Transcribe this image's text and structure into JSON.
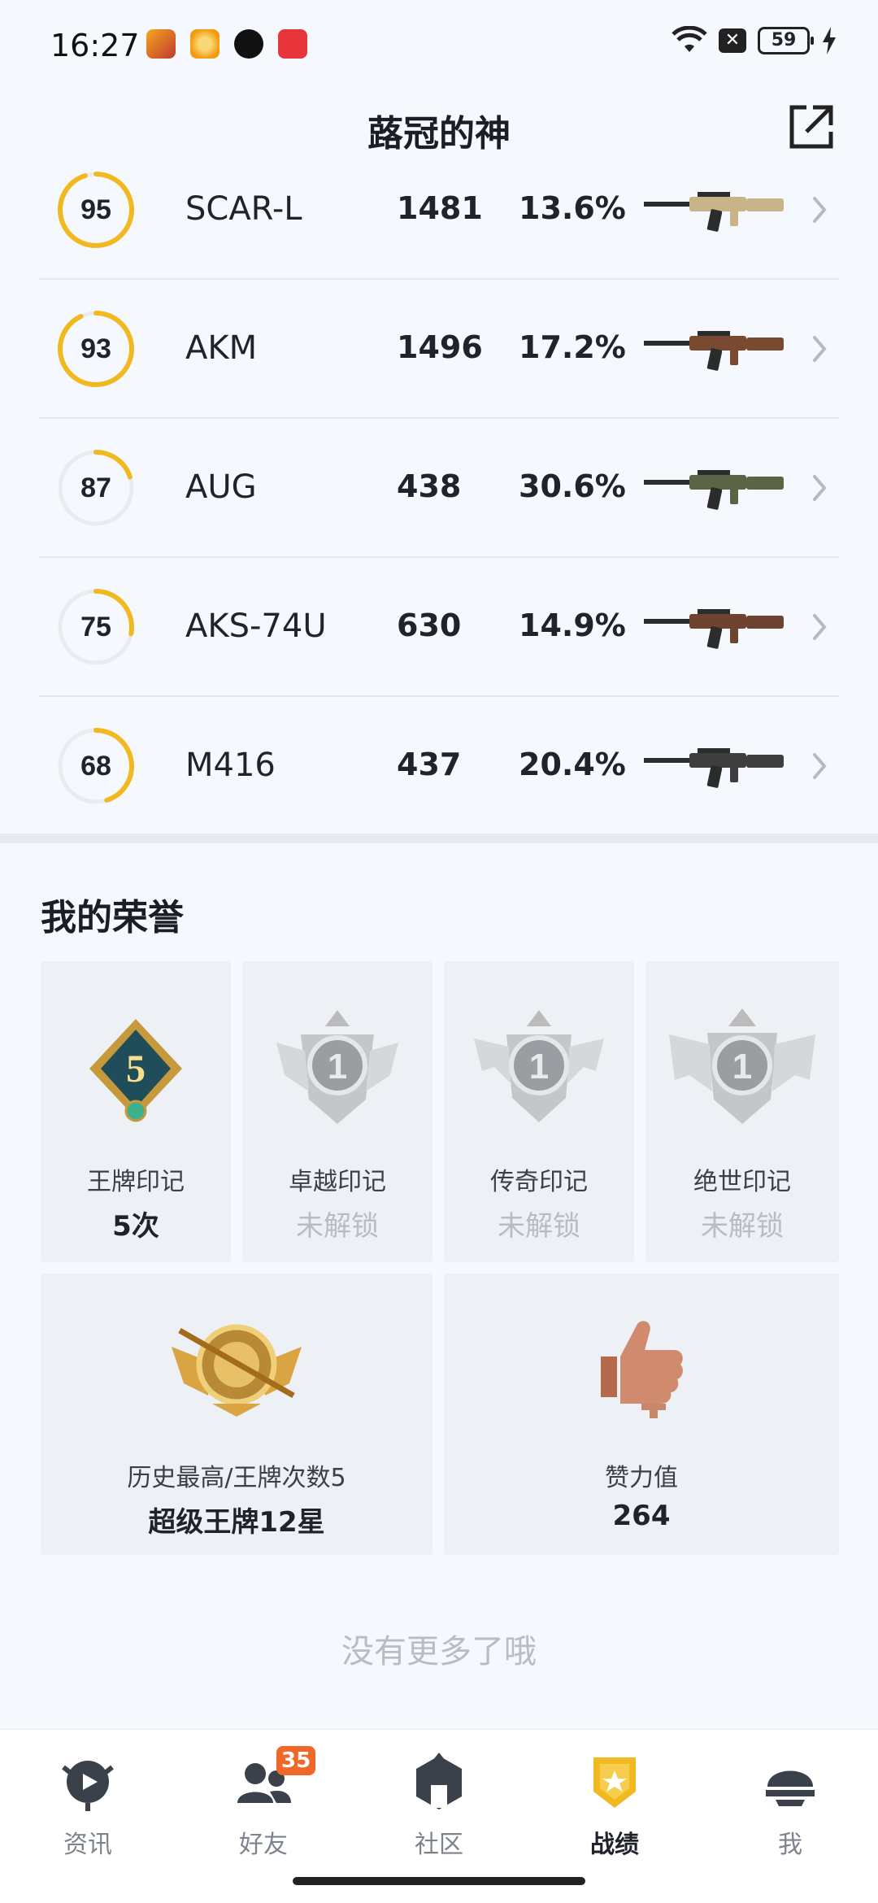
{
  "status_bar": {
    "time": "16:27",
    "battery": "59",
    "icons": [
      "game-app-icon",
      "gold-app-icon",
      "bear-app-icon",
      "music-app-icon"
    ],
    "sys_icons": [
      "wifi-icon",
      "notification-off-icon",
      "battery-icon",
      "charging-icon"
    ]
  },
  "header": {
    "title": "蕗冠的神",
    "share_icon": "share-icon"
  },
  "weapons": [
    {
      "score": "95",
      "progress": 0.95,
      "name": "SCAR-L",
      "kills": "1481",
      "rate": "13.6%",
      "color": "#c9b48a"
    },
    {
      "score": "93",
      "progress": 0.93,
      "name": "AKM",
      "kills": "1496",
      "rate": "17.2%",
      "color": "#7a4a30"
    },
    {
      "score": "87",
      "progress": 0.2,
      "name": "AUG",
      "kills": "438",
      "rate": "30.6%",
      "color": "#5b6545"
    },
    {
      "score": "75",
      "progress": 0.28,
      "name": "AKS-74U",
      "kills": "630",
      "rate": "14.9%",
      "color": "#6e4430"
    },
    {
      "score": "68",
      "progress": 0.45,
      "name": "M416",
      "kills": "437",
      "rate": "20.4%",
      "color": "#3e3e3e"
    }
  ],
  "honor": {
    "title": "我的荣誉",
    "cards_small": [
      {
        "label": "王牌印记",
        "value": "5次",
        "locked": false,
        "badge_num": "5"
      },
      {
        "label": "卓越印记",
        "value": "未解锁",
        "locked": true,
        "badge_num": "1"
      },
      {
        "label": "传奇印记",
        "value": "未解锁",
        "locked": true,
        "badge_num": "1"
      },
      {
        "label": "绝世印记",
        "value": "未解锁",
        "locked": true,
        "badge_num": "1"
      }
    ],
    "cards_large": [
      {
        "label": "历史最高/王牌次数5",
        "value": "超级王牌12星"
      },
      {
        "label": "赞力值",
        "value": "264"
      }
    ]
  },
  "footer_text": "没有更多了哦",
  "nav": {
    "items": [
      {
        "label": "资讯",
        "icon": "news-icon"
      },
      {
        "label": "好友",
        "icon": "friends-icon",
        "badge": "35"
      },
      {
        "label": "社区",
        "icon": "community-icon"
      },
      {
        "label": "战绩",
        "icon": "record-icon",
        "active": true
      },
      {
        "label": "我",
        "icon": "profile-icon"
      }
    ]
  },
  "colors": {
    "accent": "#f2b820",
    "ring_track": "#e8ecf0",
    "active_nav": "#f2b820"
  }
}
